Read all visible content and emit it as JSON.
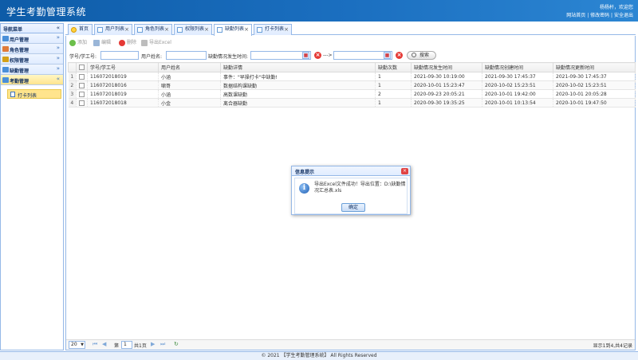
{
  "header": {
    "title": "学生考勤管理系统",
    "welcome": "杨杨杆，欢迎您",
    "links": [
      "网站首页",
      "修改密码",
      "安全退出"
    ],
    "separator": " | "
  },
  "sidebar": {
    "title": "导航菜单",
    "collapse_icon": "«",
    "items": [
      {
        "label": "用户管理",
        "icon": "users-icon",
        "color": "#4a8fd8"
      },
      {
        "label": "角色管理",
        "icon": "roles-icon",
        "color": "#e07b39"
      },
      {
        "label": "权限管理",
        "icon": "key-icon",
        "color": "#d4a017"
      },
      {
        "label": "缺勤管理",
        "icon": "absence-icon",
        "color": "#4a8fd8"
      },
      {
        "label": "考勤管理",
        "icon": "attendance-icon",
        "color": "#4a8fd8",
        "active": true
      }
    ],
    "sub_item": {
      "label": "打卡列表"
    }
  },
  "tabs": [
    {
      "label": "首页",
      "closable": false
    },
    {
      "label": "用户列表",
      "closable": true
    },
    {
      "label": "角色列表",
      "closable": true
    },
    {
      "label": "权限列表",
      "closable": true
    },
    {
      "label": "缺勤列表",
      "closable": true,
      "active": true
    },
    {
      "label": "打卡列表",
      "closable": true
    }
  ],
  "toolbar": {
    "add": "添加",
    "edit": "编辑",
    "delete": "删除",
    "export": "导出Excel"
  },
  "search": {
    "student_id_label": "学号/学工号:",
    "username_label": "用户姓名:",
    "time_label": "缺勤情况发生时间:",
    "range_sep": "--->",
    "search_button": "搜索"
  },
  "table": {
    "columns": [
      "学号/学工号",
      "用户姓名",
      "缺勤详情",
      "缺勤次数",
      "缺勤情况发生时间",
      "缺勤情况创建时间",
      "缺勤情况更新时间"
    ],
    "rows": [
      {
        "no": "1",
        "student_id": "116072018019",
        "name": "小涵",
        "detail": "事件：\"早操打卡\"中缺勤!",
        "count": "1",
        "happened": "2021-09-30 10:19:00",
        "created": "2021-09-30 17:45:37",
        "updated": "2021-09-30 17:45:37"
      },
      {
        "no": "2",
        "student_id": "116072018016",
        "name": "啸哥",
        "detail": "数据结构课缺勤",
        "count": "1",
        "happened": "2020-10-01 15:23:47",
        "created": "2020-10-02 15:23:51",
        "updated": "2020-10-02 15:23:51"
      },
      {
        "no": "3",
        "student_id": "116072018019",
        "name": "小涵",
        "detail": "高数课缺勤",
        "count": "2",
        "happened": "2020-09-23 20:05:21",
        "created": "2020-10-01 19:42:00",
        "updated": "2020-10-01 20:05:28"
      },
      {
        "no": "4",
        "student_id": "116072018018",
        "name": "小金",
        "detail": "离合器缺勤",
        "count": "1",
        "happened": "2020-09-30 19:35:25",
        "created": "2020-10-01 10:13:54",
        "updated": "2020-10-01 19:47:50"
      }
    ]
  },
  "pager": {
    "page_size": "20",
    "page_label": "第",
    "page_value": "1",
    "total_pages": "共1页",
    "info": "显示1到4,共4记录"
  },
  "dialog": {
    "title": "信息提示",
    "message": "导出Excel文件成功！导出位置：D:\\缺勤情况汇总表.xls",
    "ok": "确定"
  },
  "footer": "© 2021 【学生考勤管理系统】 All Rights Reserved"
}
